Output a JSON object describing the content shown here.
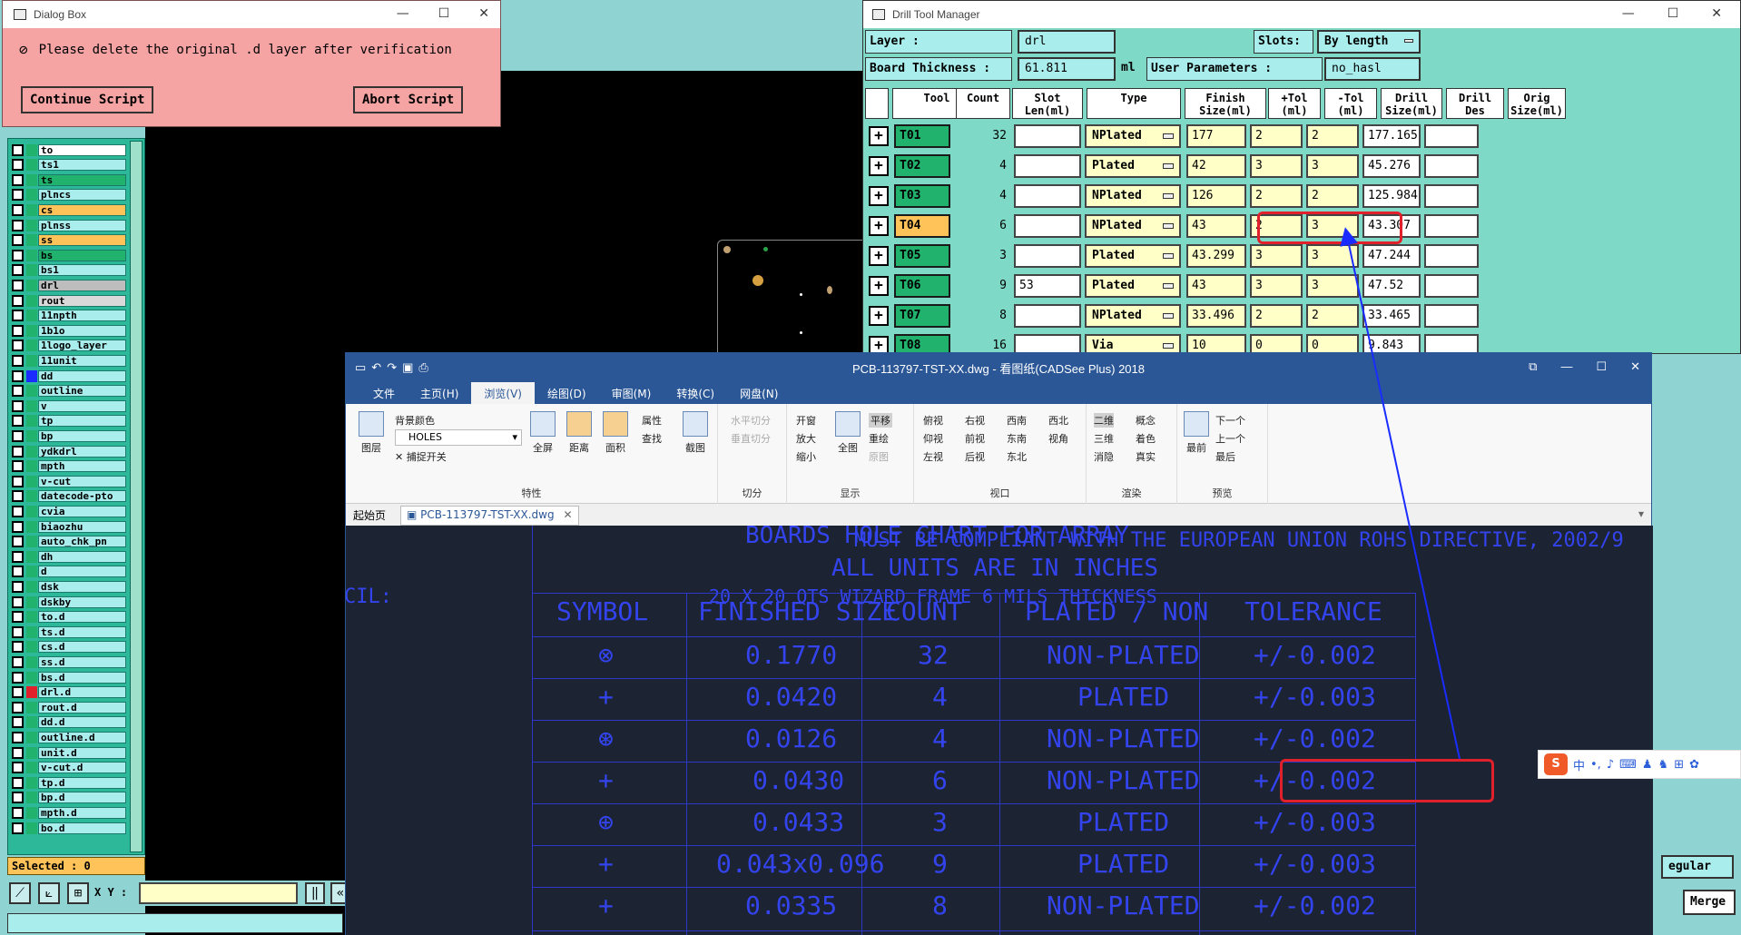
{
  "dialog": {
    "title": "Dialog Box",
    "message": "Please delete the original .d layer after verification",
    "continue_label": "Continue Script",
    "abort_label": "Abort Script"
  },
  "layers": [
    {
      "name": "to",
      "color": "#ffffff"
    },
    {
      "name": "ts1",
      "color": "#a9eded"
    },
    {
      "name": "ts",
      "color": "#21b26d"
    },
    {
      "name": "plncs",
      "color": "#a9eded"
    },
    {
      "name": "cs",
      "color": "#ffc35a"
    },
    {
      "name": "plnss",
      "color": "#a9eded"
    },
    {
      "name": "ss",
      "color": "#ffc35a"
    },
    {
      "name": "bs",
      "color": "#21b26d"
    },
    {
      "name": "bs1",
      "color": "#a9eded"
    },
    {
      "name": "drl",
      "color": "#bdbdbd"
    },
    {
      "name": "rout",
      "color": "#d9d9d9"
    },
    {
      "name": "11npth",
      "color": "#a9eded"
    },
    {
      "name": "1b1o",
      "color": "#a9eded"
    },
    {
      "name": "1logo_layer",
      "color": "#a9eded"
    },
    {
      "name": "11unit",
      "color": "#a9eded"
    },
    {
      "name": "dd",
      "color": "#a9eded"
    },
    {
      "name": "outline",
      "color": "#a9eded"
    },
    {
      "name": "v",
      "color": "#a9eded"
    },
    {
      "name": "tp",
      "color": "#a9eded"
    },
    {
      "name": "bp",
      "color": "#a9eded"
    },
    {
      "name": "ydkdrl",
      "color": "#a9eded"
    },
    {
      "name": "mpth",
      "color": "#a9eded"
    },
    {
      "name": "v-cut",
      "color": "#a9eded"
    },
    {
      "name": "datecode-pto",
      "color": "#a9eded"
    },
    {
      "name": "cvia",
      "color": "#a9eded"
    },
    {
      "name": "biaozhu",
      "color": "#a9eded"
    },
    {
      "name": "auto_chk_pn",
      "color": "#a9eded"
    },
    {
      "name": "dh",
      "color": "#a9eded"
    },
    {
      "name": "d",
      "color": "#a9eded"
    },
    {
      "name": "dsk",
      "color": "#a9eded"
    },
    {
      "name": "dskby",
      "color": "#a9eded"
    },
    {
      "name": "to.d",
      "color": "#a9eded"
    },
    {
      "name": "ts.d",
      "color": "#a9eded"
    },
    {
      "name": "cs.d",
      "color": "#a9eded"
    },
    {
      "name": "ss.d",
      "color": "#a9eded"
    },
    {
      "name": "bs.d",
      "color": "#a9eded"
    },
    {
      "name": "drl.d",
      "color": "#a9eded"
    },
    {
      "name": "rout.d",
      "color": "#a9eded"
    },
    {
      "name": "dd.d",
      "color": "#a9eded"
    },
    {
      "name": "outline.d",
      "color": "#a9eded"
    },
    {
      "name": "unit.d",
      "color": "#a9eded"
    },
    {
      "name": "v-cut.d",
      "color": "#a9eded"
    },
    {
      "name": "tp.d",
      "color": "#a9eded"
    },
    {
      "name": "bp.d",
      "color": "#a9eded"
    },
    {
      "name": "mpth.d",
      "color": "#a9eded"
    },
    {
      "name": "bo.d",
      "color": "#a9eded"
    }
  ],
  "layer_color_markers": {
    "dd": "#1a2cff",
    "drl.d": "#e0202a",
    "drl": "#21b26d"
  },
  "selected_label": "Selected : 0",
  "xy_label": "X Y :",
  "drill_manager": {
    "title": "Drill Tool Manager",
    "layer_label": "Layer            :",
    "layer_value": "drl",
    "slots_label": "Slots:",
    "slots_value": "By length",
    "thickness_label": "Board Thickness :",
    "thickness_value": "61.811",
    "thickness_unit": "ml",
    "user_params_label": "User Parameters :",
    "user_params_value": "no_hasl",
    "headers": [
      "Tool",
      "Count",
      "Slot\nLen(ml)",
      "Type",
      "Finish\nSize(ml)",
      "+Tol\n(ml)",
      "-Tol\n(ml)",
      "Drill\nSize(ml)",
      "Drill\nDes",
      "Orig\nSize(ml)"
    ],
    "rows": [
      {
        "tool": "T01",
        "count": "32",
        "slot": "",
        "type": "NPlated",
        "finish": "177",
        "ptol": "2",
        "ntol": "2",
        "drill": "177.165"
      },
      {
        "tool": "T02",
        "count": "4",
        "slot": "",
        "type": "Plated",
        "finish": "42",
        "ptol": "3",
        "ntol": "3",
        "drill": "45.276"
      },
      {
        "tool": "T03",
        "count": "4",
        "slot": "",
        "type": "NPlated",
        "finish": "126",
        "ptol": "2",
        "ntol": "2",
        "drill": "125.984"
      },
      {
        "tool": "T04",
        "count": "6",
        "slot": "",
        "type": "NPlated",
        "finish": "43",
        "ptol": "2",
        "ntol": "3",
        "drill": "43.307"
      },
      {
        "tool": "T05",
        "count": "3",
        "slot": "",
        "type": "Plated",
        "finish": "43.299",
        "ptol": "3",
        "ntol": "3",
        "drill": "47.244"
      },
      {
        "tool": "T06",
        "count": "9",
        "slot": "53",
        "type": "Plated",
        "finish": "43",
        "ptol": "3",
        "ntol": "3",
        "drill": "47.52"
      },
      {
        "tool": "T07",
        "count": "8",
        "slot": "",
        "type": "NPlated",
        "finish": "33.496",
        "ptol": "2",
        "ntol": "2",
        "drill": "33.465"
      },
      {
        "tool": "T08",
        "count": "16",
        "slot": "",
        "type": "Via",
        "finish": "10",
        "ptol": "0",
        "ntol": "0",
        "drill": "9.843"
      }
    ]
  },
  "cad": {
    "title": "PCB-113797-TST-XX.dwg - 看图纸(CADSee Plus) 2018",
    "menus": [
      "文件",
      "主页(H)",
      "浏览(V)",
      "绘图(D)",
      "审图(M)",
      "转换(C)",
      "网盘(N)"
    ],
    "ribbon": {
      "layer_btn": "图层",
      "bg_color": "背景颜色",
      "holes_value": "HOLES",
      "snap_toggle": "捕捉开关",
      "fullscreen": "全屏",
      "distance": "距离",
      "area": "面积",
      "attr": "属性",
      "find": "查找",
      "screenshot": "截图",
      "group_props": "特性",
      "h_split": "水平切分",
      "v_split": "垂直切分",
      "group_split": "切分",
      "zoom_open": "开窗",
      "zoom_in": "放大",
      "zoom_out": "缩小",
      "full_map": "全图",
      "pan": "平移",
      "regen": "重绘",
      "original": "原图",
      "group_display": "显示",
      "views": [
        "俯视",
        "右视",
        "西南",
        "西北",
        "仰视",
        "前视",
        "东南",
        "视角",
        "左视",
        "后视",
        "东北"
      ],
      "group_viewport": "视口",
      "render": [
        "二维",
        "概念",
        "三维",
        "着色",
        "消隐",
        "真实"
      ],
      "group_render": "渲染",
      "front": "最前",
      "next": "下一个",
      "prev": "上一个",
      "last": "最后",
      "group_preview": "预览"
    },
    "tabs": {
      "home": "起始页",
      "doc": "PCB-113797-TST-XX.dwg"
    },
    "drawing": {
      "overlap1": "BOARDS HOLE CHART FOR ARRAY",
      "overlap2": "MUST BE COMPLIANT WITH THE EUROPEAN UNION ROHS DIRECTIVE, 2002/9",
      "units": "ALL UNITS ARE IN INCHES",
      "frame": "20 X 20 QTS WIZARD FRAME  6 MILS THICKNESS",
      "cil": "CIL:",
      "headers": [
        "SYMBOL",
        "FINISHED SIZE",
        "COUNT",
        "PLATED / NON",
        "TOLERANCE"
      ],
      "rows": [
        {
          "symbol": "⊗",
          "size": "0.1770",
          "count": "32",
          "plated": "NON-PLATED",
          "tol": "+/-0.002"
        },
        {
          "symbol": "+",
          "size": "0.0420",
          "count": "4",
          "plated": "PLATED",
          "tol": "+/-0.003"
        },
        {
          "symbol": "⊛",
          "size": "0.0126",
          "count": "4",
          "plated": "NON-PLATED",
          "tol": "+/-0.002"
        },
        {
          "symbol": "+",
          "size": "0.0430",
          "count": "6",
          "plated": "NON-PLATED",
          "tol": "+/-0.002"
        },
        {
          "symbol": "⊕",
          "size": "0.0433",
          "count": "3",
          "plated": "PLATED",
          "tol": "+/-0.003"
        },
        {
          "symbol": "+",
          "size": "0.043x0.096",
          "count": "9",
          "plated": "PLATED",
          "tol": "+/-0.003"
        },
        {
          "symbol": "+",
          "size": "0.0335",
          "count": "8",
          "plated": "NON-PLATED",
          "tol": "+/-0.002"
        }
      ]
    }
  },
  "right": {
    "regular": "egular",
    "merge": "Merge",
    "ime_cn": "中"
  }
}
